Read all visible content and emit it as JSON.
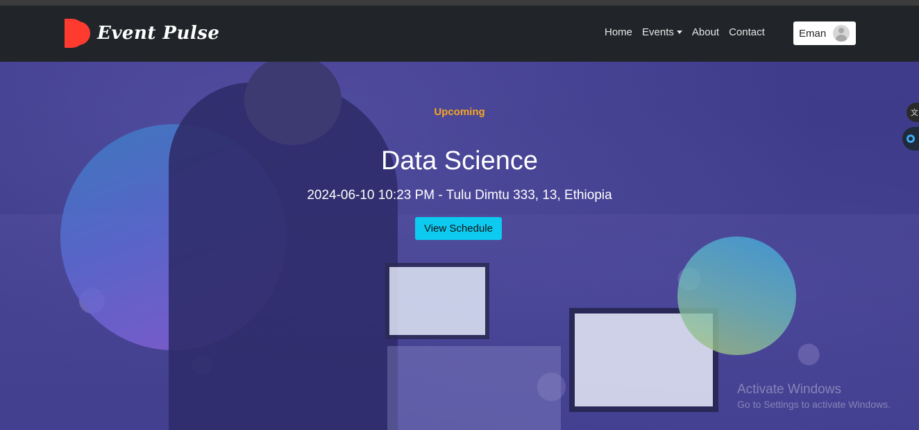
{
  "brand": {
    "name": "Event Pulse",
    "logo_color": "#ff3b30"
  },
  "nav": {
    "items": [
      {
        "label": "Home"
      },
      {
        "label": "Events"
      },
      {
        "label": "About"
      },
      {
        "label": "Contact"
      }
    ],
    "user": {
      "name": "Eman"
    }
  },
  "hero": {
    "badge": "Upcoming",
    "title": "Data Science",
    "subtitle": "2024-06-10 10:23 PM - Tulu Dimtu 333, 13, Ethiopia",
    "button_label": "View Schedule",
    "badge_color": "#f5a623",
    "button_color": "#0dcaf0"
  },
  "side_widgets": {
    "translate_glyph": "文"
  },
  "watermark": {
    "line1": "Activate Windows",
    "line2": "Go to Settings to activate Windows."
  }
}
